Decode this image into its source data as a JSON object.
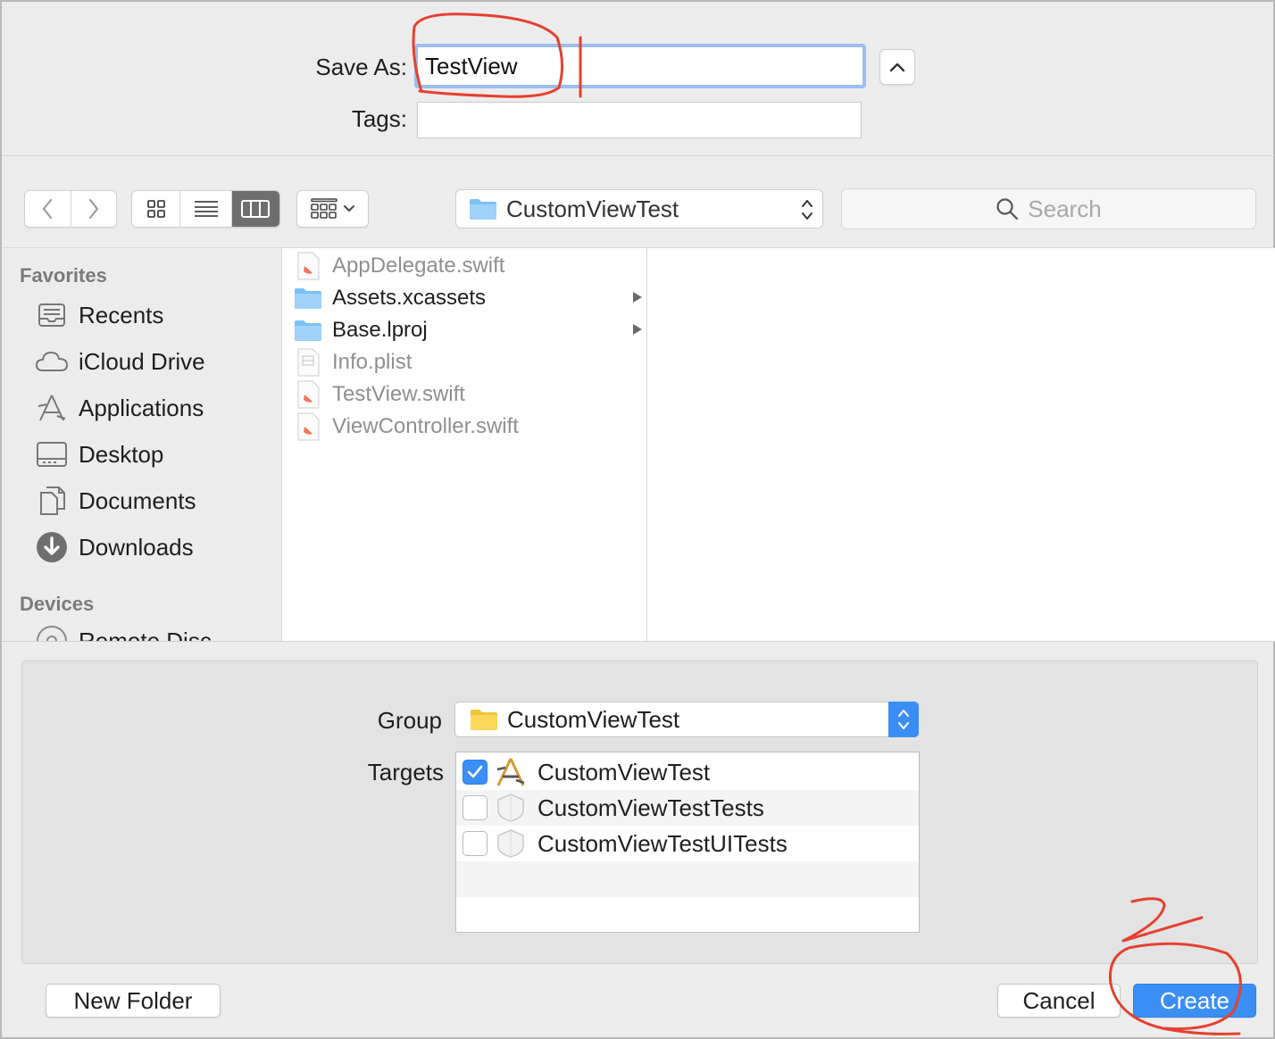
{
  "save": {
    "label": "Save As:",
    "value": "TestView"
  },
  "tags": {
    "label": "Tags:",
    "value": ""
  },
  "toolbar": {
    "back_icon": "chevron-left-icon",
    "forward_icon": "chevron-right-icon",
    "views": [
      "icon-view",
      "list-view",
      "column-view"
    ],
    "active_view": "column-view",
    "location": "CustomViewTest",
    "search_placeholder": "Search"
  },
  "sidebar": {
    "favorites_title": "Favorites",
    "items": [
      {
        "label": "Recents",
        "icon": "recents-icon"
      },
      {
        "label": "iCloud Drive",
        "icon": "cloud-icon"
      },
      {
        "label": "Applications",
        "icon": "applications-icon"
      },
      {
        "label": "Desktop",
        "icon": "desktop-icon"
      },
      {
        "label": "Documents",
        "icon": "documents-icon"
      },
      {
        "label": "Downloads",
        "icon": "downloads-icon"
      }
    ],
    "devices_title": "Devices",
    "devices": [
      {
        "label": "Remote Disc",
        "icon": "disc-icon"
      }
    ]
  },
  "files": [
    {
      "name": "AppDelegate.swift",
      "type": "swift",
      "dim": true
    },
    {
      "name": "Assets.xcassets",
      "type": "folder",
      "dim": false
    },
    {
      "name": "Base.lproj",
      "type": "folder",
      "dim": false
    },
    {
      "name": "Info.plist",
      "type": "plist",
      "dim": true
    },
    {
      "name": "TestView.swift",
      "type": "swift",
      "dim": true
    },
    {
      "name": "ViewController.swift",
      "type": "swift",
      "dim": true
    }
  ],
  "group": {
    "label": "Group",
    "value": "CustomViewTest"
  },
  "targets": {
    "label": "Targets",
    "rows": [
      {
        "name": "CustomViewTest",
        "checked": true
      },
      {
        "name": "CustomViewTestTests",
        "checked": false
      },
      {
        "name": "CustomViewTestUITests",
        "checked": false
      }
    ]
  },
  "buttons": {
    "new_folder": "New Folder",
    "cancel": "Cancel",
    "create": "Create"
  },
  "colors": {
    "accent": "#3b8ef3",
    "annotation": "#e5402f"
  }
}
